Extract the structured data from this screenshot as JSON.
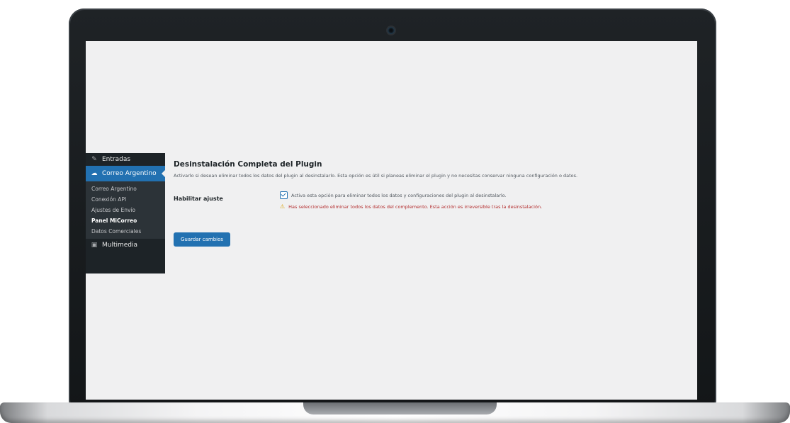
{
  "sidebar": {
    "top_items": [
      {
        "label": "Entradas",
        "icon": "pin-icon"
      },
      {
        "label": "Correo Argentino",
        "icon": "cloud-icon"
      }
    ],
    "submenu": [
      "Correo Argentino",
      "Conexión API",
      "Ajustes de Envío",
      "Panel MiCorreo",
      "Datos Comerciales"
    ],
    "current_submenu": "Panel MiCorreo",
    "bottom_item": {
      "label": "Multimedia",
      "icon": "media-icon"
    }
  },
  "main": {
    "title": "Desinstalación Completa del Plugin",
    "description": "Activarlo si desean eliminar todos los datos del plugin al desinstalarlo. Esta opción es útil si planeas eliminar el plugin y no necesitas conservar ninguna configuración o datos.",
    "field_label": "Habilitar ajuste",
    "checkbox_text": "Activa esta opción para eliminar todos los datos y configuraciones del plugin al desinstalarlo.",
    "warning_text": "Has seleccionado eliminar todos los datos del complemento. Esta acción es irreversible tras la desinstalación.",
    "save_button": "Guardar cambios"
  },
  "colors": {
    "accent": "#2271b1",
    "sidebar_bg": "#1d2327",
    "warning": "#b32d2e"
  }
}
